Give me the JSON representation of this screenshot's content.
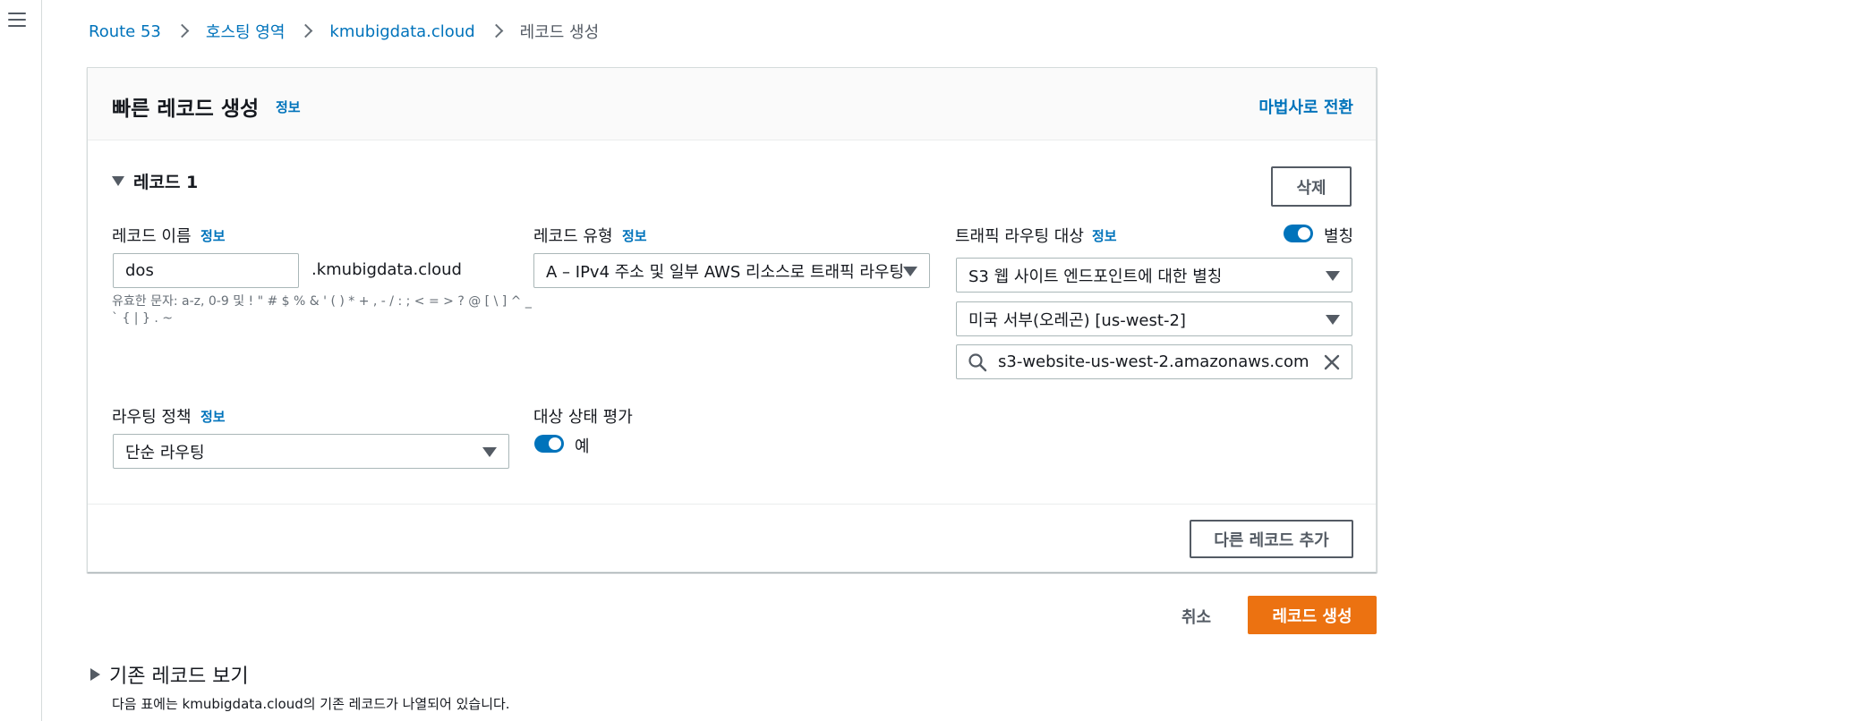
{
  "breadcrumb": {
    "items": [
      "Route 53",
      "호스팅 영역",
      "kmubigdata.cloud"
    ],
    "current": "레코드 생성"
  },
  "panel": {
    "title": "빠른 레코드 생성",
    "info_label": "정보",
    "wizard_link": "마법사로 전환"
  },
  "record": {
    "section_label": "레코드 1",
    "delete_label": "삭제",
    "name": {
      "label": "레코드 이름",
      "info": "정보",
      "value": "dos",
      "domain_suffix": ".kmubigdata.cloud",
      "hint": "유효한 문자: a-z, 0-9 및 ! \" # $ % & ' ( ) * + , - / : ; < = > ? @ [ \\ ] ^ _ ` { | } . ~"
    },
    "type": {
      "label": "레코드 유형",
      "info": "정보",
      "value": "A – IPv4 주소 및 일부 AWS 리소스로 트래픽 라우팅"
    },
    "target": {
      "label": "트래픽 라우팅 대상",
      "info": "정보",
      "alias_label": "별칭",
      "alias_enabled": true,
      "endpoint": "S3 웹 사이트 엔드포인트에 대한 별칭",
      "region": "미국 서부(오레곤) [us-west-2]",
      "search_value": "s3-website-us-west-2.amazonaws.com"
    },
    "routing_policy": {
      "label": "라우팅 정책",
      "info": "정보",
      "value": "단순 라우팅"
    },
    "health": {
      "label": "대상 상태 평가",
      "toggle_label": "예",
      "enabled": true
    }
  },
  "add_record_label": "다른 레코드 추가",
  "actions": {
    "cancel": "취소",
    "create": "레코드 생성"
  },
  "existing": {
    "title": "기존 레코드 보기",
    "description": "다음 표에는 kmubigdata.cloud의 기존 레코드가 나열되어 있습니다."
  },
  "colors": {
    "link": "#0073bb",
    "primary": "#ec7211",
    "toggle": "#0073bb",
    "border": "#aab7b8"
  }
}
